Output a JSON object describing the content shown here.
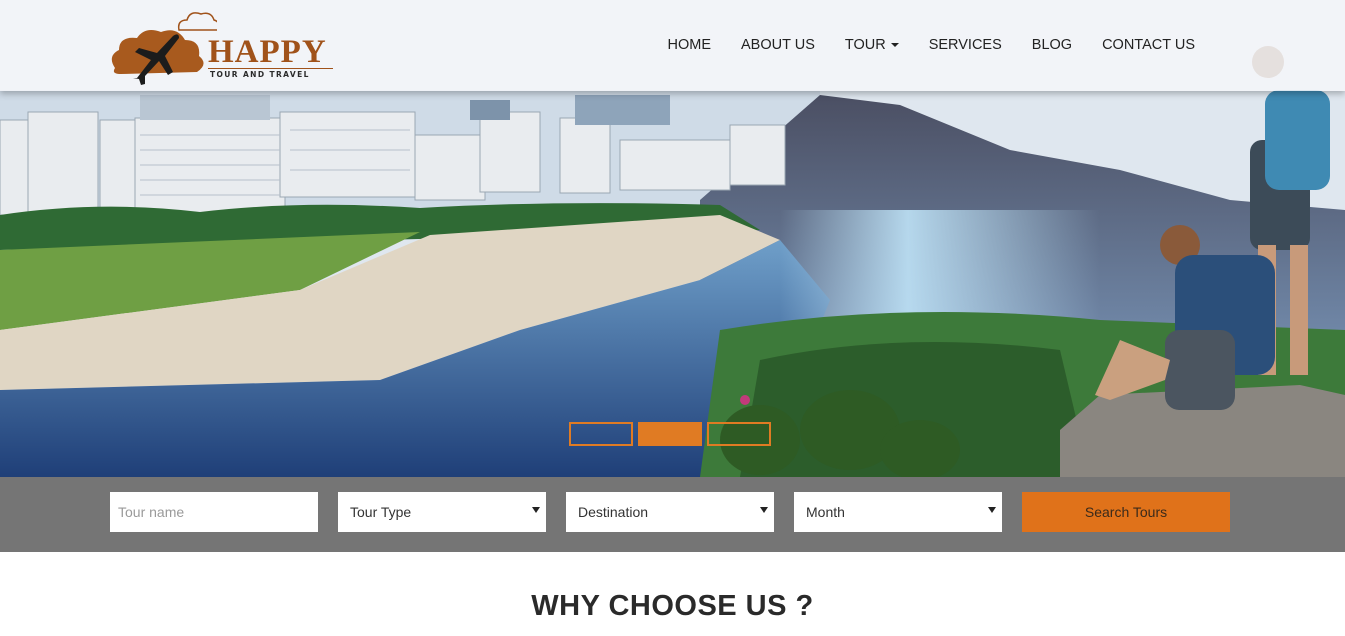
{
  "brand": {
    "name": "HAPPY",
    "tagline": "TOUR AND TRAVEL",
    "accent": "#a0521a"
  },
  "nav": {
    "items": [
      {
        "label": "HOME",
        "dropdown": false
      },
      {
        "label": "ABOUT US",
        "dropdown": false
      },
      {
        "label": "TOUR",
        "dropdown": true
      },
      {
        "label": "SERVICES",
        "dropdown": false
      },
      {
        "label": "BLOG",
        "dropdown": false
      },
      {
        "label": "CONTACT US",
        "dropdown": false
      }
    ]
  },
  "slider": {
    "slide_count": 3,
    "active_index": 1,
    "indicator_color": "#e07b23"
  },
  "search": {
    "tour_name_placeholder": "Tour name",
    "tour_type_selected": "Tour Type",
    "destination_selected": "Destination",
    "month_selected": "Month",
    "submit_label": "Search Tours",
    "button_color": "#e0721a"
  },
  "why": {
    "title": "WHY CHOOSE US ?"
  }
}
